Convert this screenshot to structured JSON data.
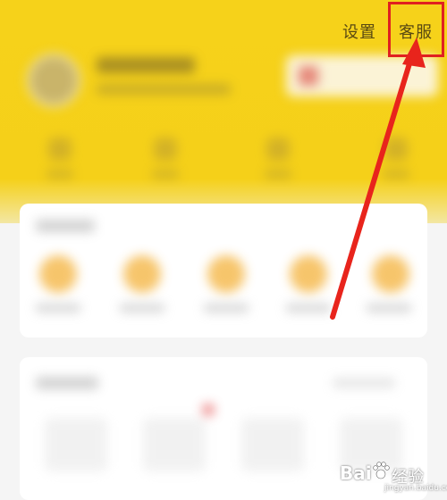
{
  "header": {
    "settings_label": "设置",
    "service_label": "客服"
  },
  "watermark": {
    "brand": "Bai",
    "brand_cn": "经验",
    "url": "jingyan.baidu.com"
  },
  "colors": {
    "header_yellow": "#f5d019",
    "highlight_red": "#e02020",
    "accent_orange": "#f4b23a"
  },
  "annotation": {
    "arrow_target": "service-link"
  }
}
